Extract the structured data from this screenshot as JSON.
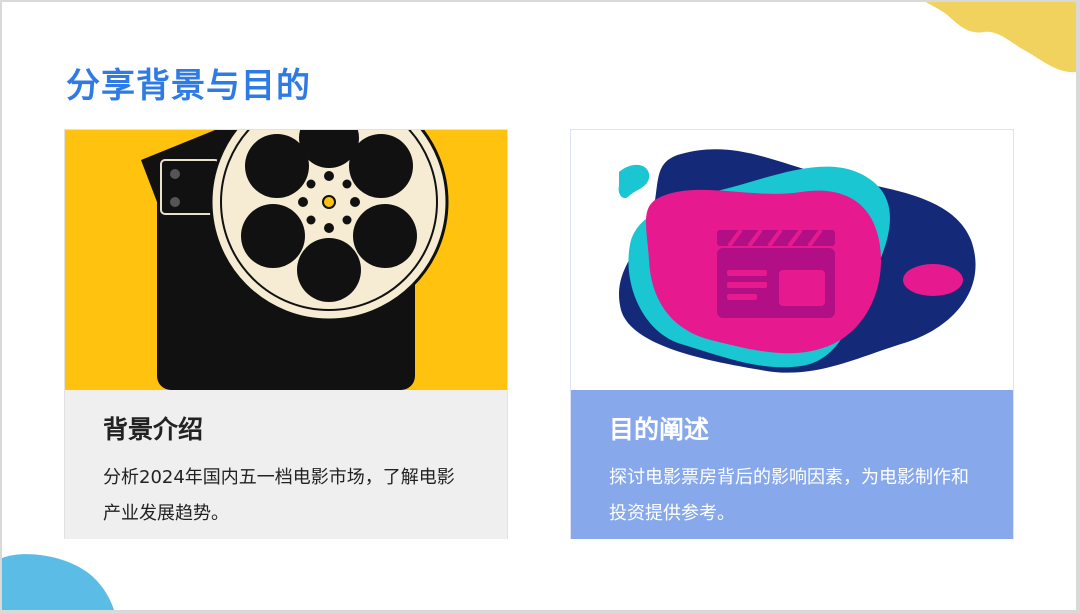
{
  "slide": {
    "title": "分享背景与目的",
    "colors": {
      "title": "#2f7be6",
      "left_image_bg": "#ffc30f",
      "right_text_bg": "#87a9ec",
      "accent_yellow": "#f2d25e",
      "accent_blue": "#5bbce6"
    }
  },
  "cards": [
    {
      "heading": "背景介绍",
      "description": "分析2024年国内五一档电影市场，了解电影产业发展趋势。",
      "image_icon": "film-reel-clapperboard-icon"
    },
    {
      "heading": "目的阐述",
      "description": "探讨电影票房背后的影响因素，为电影制作和投资提供参考。",
      "image_icon": "clapperboard-blob-icon"
    }
  ]
}
